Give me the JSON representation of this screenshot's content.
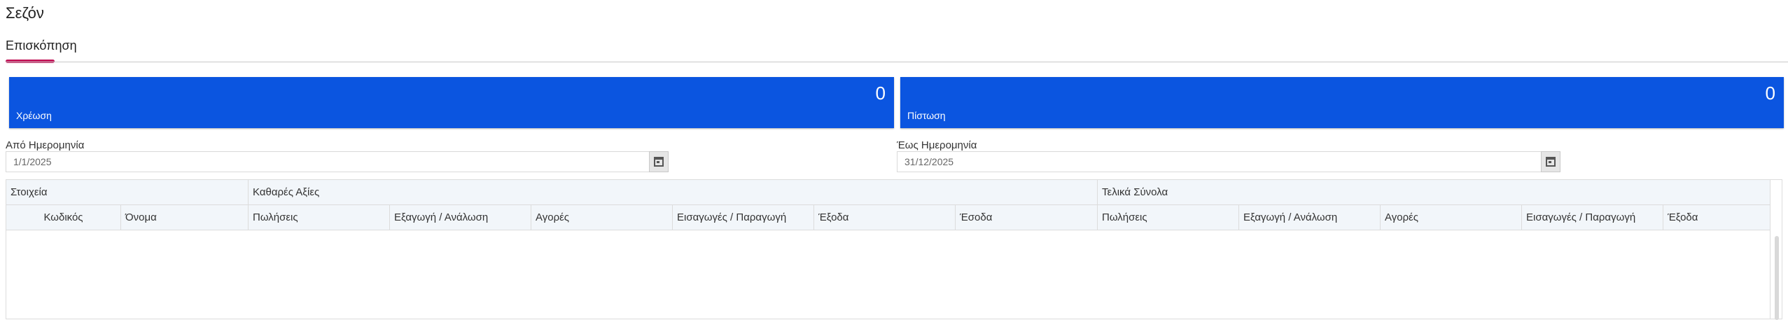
{
  "page": {
    "title": "Σεζόν"
  },
  "tabs": [
    {
      "label": "Επισκόπηση",
      "active": true
    }
  ],
  "cards": {
    "debit": {
      "label": "Χρέωση",
      "value": "0"
    },
    "credit": {
      "label": "Πίστωση",
      "value": "0"
    }
  },
  "filters": {
    "from": {
      "label": "Από Ημερομηνία",
      "value": "1/1/2025"
    },
    "to": {
      "label": "Έως Ημερομηνία",
      "value": "31/12/2025"
    }
  },
  "grid": {
    "groups": [
      "Στοιχεία",
      "Καθαρές Αξίες",
      "Τελικά Σύνολα"
    ],
    "columns": [
      "Κωδικός",
      "Όνομα",
      "Πωλήσεις",
      "Εξαγωγή / Ανάλωση",
      "Αγορές",
      "Εισαγωγές / Παραγωγή",
      "Έξοδα",
      "Έσοδα",
      "Πωλήσεις",
      "Εξαγωγή / Ανάλωση",
      "Αγορές",
      "Εισαγωγές / Παραγωγή",
      "Έξοδα"
    ],
    "rows": []
  },
  "colors": {
    "accent": "#c2185b",
    "card": "#0b55e0",
    "header": "#f2f6fa"
  },
  "icons": {
    "date_picker": "calendar-icon"
  }
}
